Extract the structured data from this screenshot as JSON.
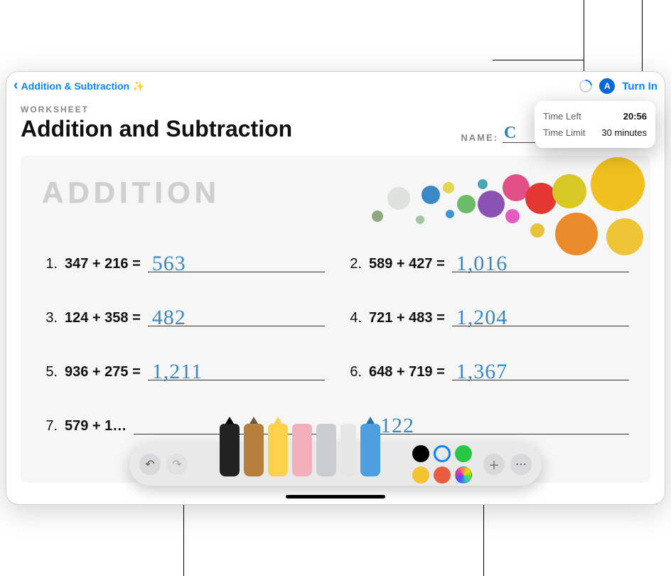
{
  "nav": {
    "back_label": "Addition & Subtraction ✨",
    "turn_in": "Turn In"
  },
  "popover": {
    "time_left_label": "Time Left",
    "time_left_value": "20:56",
    "time_limit_label": "Time Limit",
    "time_limit_value": "30 minutes"
  },
  "doc": {
    "eyebrow": "WORKSHEET",
    "title": "Addition and Subtraction",
    "name_label": "NAME:",
    "name_value": "C"
  },
  "section": {
    "header": "ADDITION"
  },
  "problems": [
    {
      "n": "1.",
      "eq": "347 + 216 =",
      "ans": "563"
    },
    {
      "n": "2.",
      "eq": "589 + 427 =",
      "ans": "1,016"
    },
    {
      "n": "3.",
      "eq": "124 + 358 =",
      "ans": "482"
    },
    {
      "n": "4.",
      "eq": "721 + 483 =",
      "ans": "1,204"
    },
    {
      "n": "5.",
      "eq": "936 + 275 =",
      "ans": "1,211"
    },
    {
      "n": "6.",
      "eq": "648 + 719 =",
      "ans": "1,367"
    },
    {
      "n": "7.",
      "eq": "579 + 1…",
      "ans": ""
    },
    {
      "n": "",
      "eq": "",
      "ans": "122"
    }
  ],
  "toolbar": {
    "tools": [
      "pen",
      "marker",
      "highlighter",
      "eraser",
      "lasso",
      "ruler",
      "crayon"
    ],
    "colors_top": [
      "#000000",
      "ring-blue",
      "#2ac742"
    ],
    "colors_bottom": [
      "#f5c331",
      "#e85d3f",
      "wheel"
    ]
  }
}
